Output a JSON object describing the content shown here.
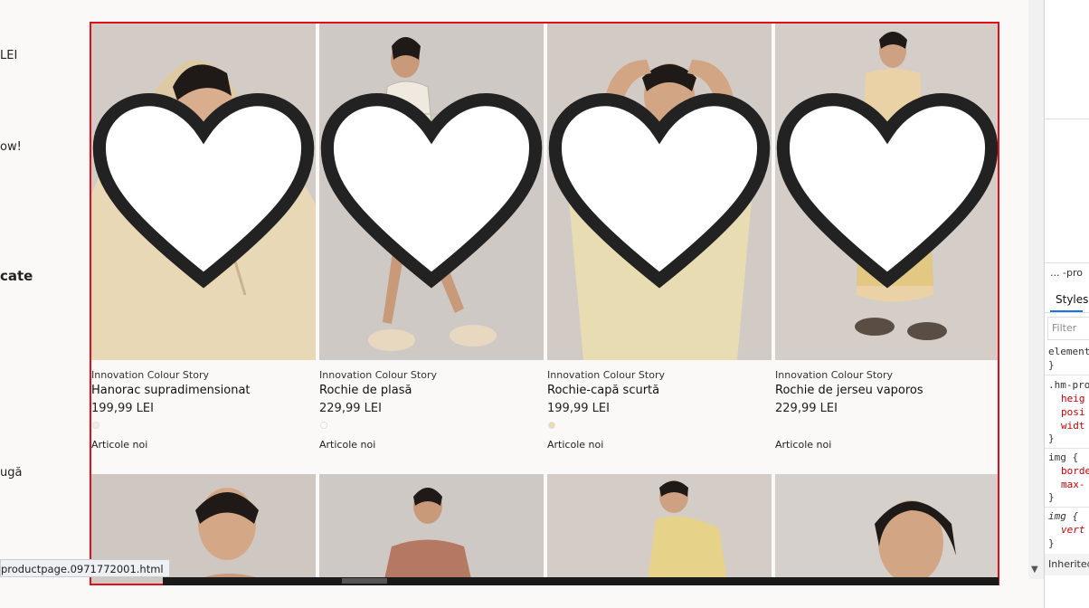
{
  "left_panel": {
    "fragments": [
      "LEI",
      "ow!",
      "cate",
      "ugă"
    ]
  },
  "products": [
    {
      "brand": "Innovation Colour Story",
      "name": "Hanorac supradimensionat",
      "price": "199,99 LEI",
      "swatch": "#f4efe6",
      "badge": "Articole noi",
      "favorite_icon": "heart-outline"
    },
    {
      "brand": "Innovation Colour Story",
      "name": "Rochie de plasă",
      "price": "229,99 LEI",
      "swatch": "#ffffff",
      "badge": "Articole noi",
      "favorite_icon": "heart-outline"
    },
    {
      "brand": "Innovation Colour Story",
      "name": "Rochie-capă scurtă",
      "price": "199,99 LEI",
      "swatch": "#e9dcae",
      "badge": "Articole noi",
      "favorite_icon": "heart-outline"
    },
    {
      "brand": "Innovation Colour Story",
      "name": "Rochie de jerseu vaporos",
      "price": "229,99 LEI",
      "swatch": "",
      "badge": "Articole noi",
      "favorite_icon": "heart-outline"
    }
  ],
  "status_bar": {
    "url": "productpage.0971772001.html"
  },
  "devtools": {
    "breadcrumb_prefix": "...",
    "breadcrumb": "-pro",
    "tab_styles": "Styles",
    "filter_placeholder": "Filter",
    "rules": [
      "element",
      "}",
      ".hm-pro",
      "heig",
      "posi",
      "widt",
      "}",
      "img {",
      "borde",
      "max-",
      "}",
      "img {",
      "vert",
      "}"
    ],
    "inherited": "Inherited"
  },
  "colors": {
    "highlight_border": "#e0101a",
    "accent": "#1a73e8"
  }
}
